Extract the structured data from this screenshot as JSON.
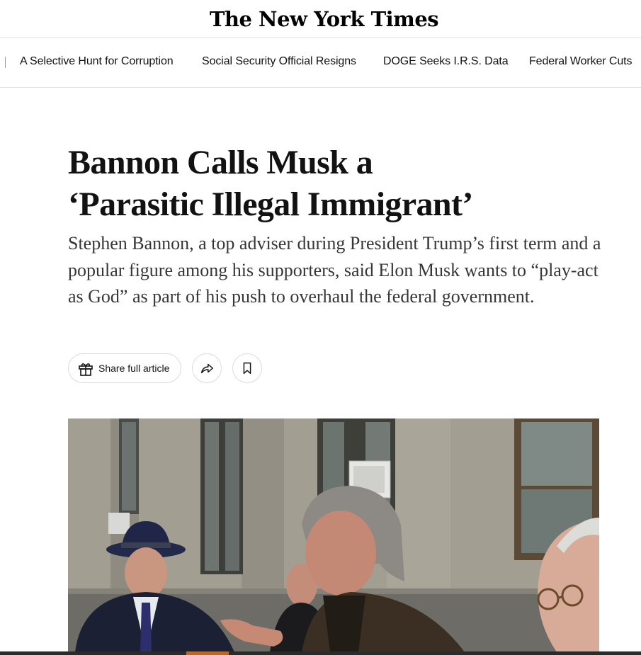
{
  "masthead": {
    "logo_text": "The New York Times"
  },
  "trending": {
    "items": [
      "A Selective Hunt for Corruption",
      "Social Security Official Resigns",
      "DOGE Seeks I.R.S. Data",
      "Federal Worker Cuts"
    ]
  },
  "article": {
    "headline_line1": "Bannon Calls Musk a",
    "headline_line2": "‘Parasitic Illegal Immigrant’",
    "summary": "Stephen Bannon, a top adviser during President Trump’s first term and a popular figure among his supporters, said Elon Musk wants to “play-act as God” as part of his push to overhaul the federal government."
  },
  "share": {
    "share_label": "Share full article",
    "gift_icon": "gift-icon",
    "share_icon": "share-arrow-icon",
    "save_icon": "bookmark-icon"
  },
  "colors": {
    "text": "#121212",
    "summary_text": "#363636",
    "divider": "#e2e2e2",
    "button_border": "#dcdcdc"
  }
}
